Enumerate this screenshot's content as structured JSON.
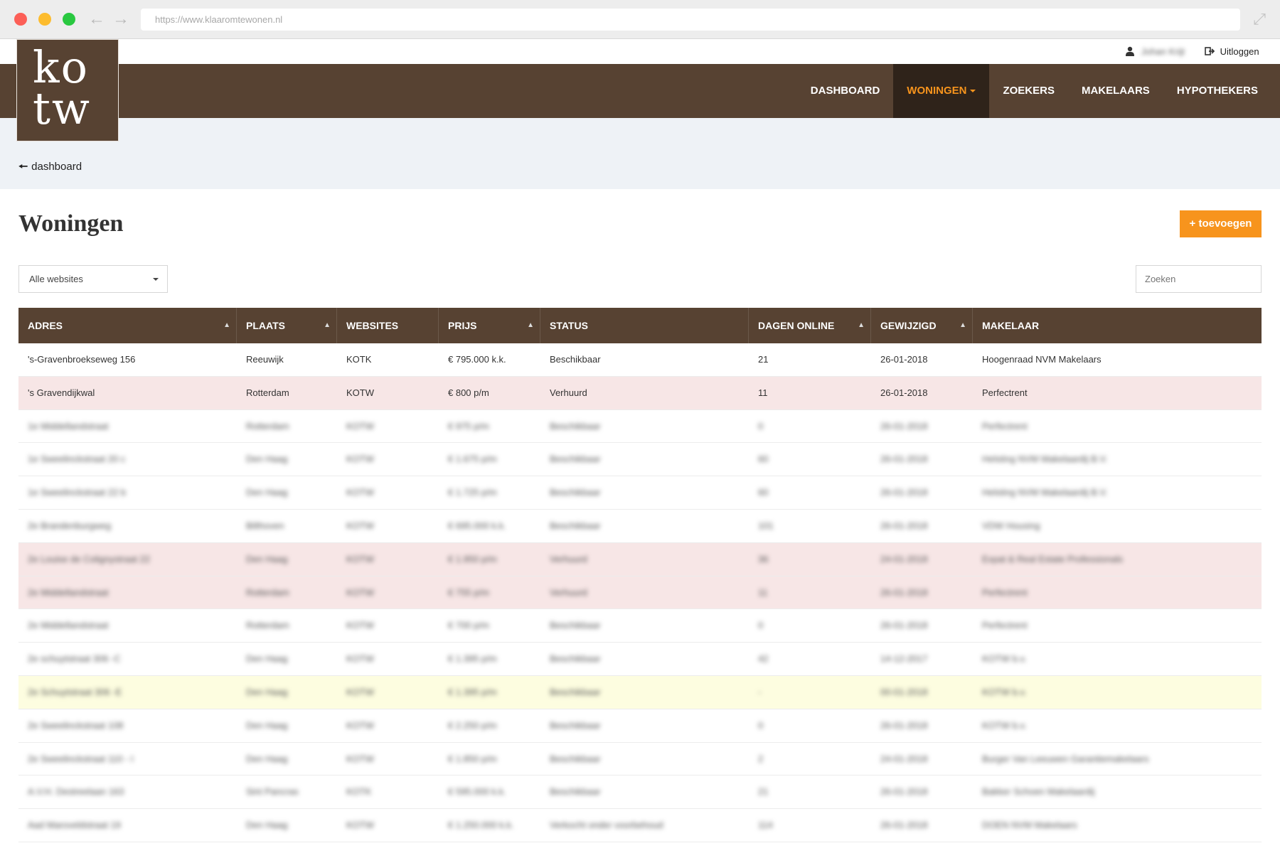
{
  "browser": {
    "url": "https://www.klaaromtewonen.nl"
  },
  "utility": {
    "user_name": "Johan Krijt",
    "logout_label": "Uitloggen"
  },
  "logo": {
    "line1": "ko",
    "line2": "tw"
  },
  "nav": {
    "items": [
      {
        "label": "DASHBOARD",
        "active": false
      },
      {
        "label": "WONINGEN",
        "active": true
      },
      {
        "label": "ZOEKERS",
        "active": false
      },
      {
        "label": "MAKELAARS",
        "active": false
      },
      {
        "label": "HYPOTHEKERS",
        "active": false
      }
    ]
  },
  "breadcrumb": {
    "back_label": "dashboard"
  },
  "page": {
    "title": "Woningen",
    "add_label": "+ toevoegen"
  },
  "filters": {
    "website_select": "Alle websites",
    "search_placeholder": "Zoeken"
  },
  "table": {
    "columns": [
      "ADRES",
      "PLAATS",
      "WEBSITES",
      "PRIJS",
      "STATUS",
      "DAGEN ONLINE",
      "GEWIJZIGD",
      "MAKELAAR"
    ],
    "rows": [
      {
        "adres": "'s-Gravenbroekseweg 156",
        "plaats": "Reeuwijk",
        "websites": "KOTK",
        "prijs": "€ 795.000 k.k.",
        "status": "Beschikbaar",
        "dagen": "21",
        "gewijzigd": "26-01-2018",
        "makelaar": "Hoogenraad NVM Makelaars",
        "highlight": "none",
        "blur": false
      },
      {
        "adres": "'s Gravendijkwal",
        "plaats": "Rotterdam",
        "websites": "KOTW",
        "prijs": "€ 800 p/m",
        "status": "Verhuurd",
        "dagen": "11",
        "gewijzigd": "26-01-2018",
        "makelaar": "Perfectrent",
        "highlight": "red",
        "blur": false
      },
      {
        "adres": "1e Middellandstraat",
        "plaats": "Rotterdam",
        "websites": "KOTW",
        "prijs": "€ 975 p/m",
        "status": "Beschikbaar",
        "dagen": "0",
        "gewijzigd": "26-01-2018",
        "makelaar": "Perfectrent",
        "highlight": "none",
        "blur": true
      },
      {
        "adres": "1e Sweelinckstraat 20 c",
        "plaats": "Den Haag",
        "websites": "KOTW",
        "prijs": "€ 1.675 p/m",
        "status": "Beschikbaar",
        "dagen": "60",
        "gewijzigd": "26-01-2018",
        "makelaar": "Helsting NVM Makelaardij B.V.",
        "highlight": "none",
        "blur": true
      },
      {
        "adres": "1e Sweelinckstraat 22 b",
        "plaats": "Den Haag",
        "websites": "KOTW",
        "prijs": "€ 1.725 p/m",
        "status": "Beschikbaar",
        "dagen": "60",
        "gewijzigd": "26-01-2018",
        "makelaar": "Helsting NVM Makelaardij B.V.",
        "highlight": "none",
        "blur": true
      },
      {
        "adres": "2e Brandenburgweg",
        "plaats": "Bilthoven",
        "websites": "KOTW",
        "prijs": "€ 695.000 k.k.",
        "status": "Beschikbaar",
        "dagen": "101",
        "gewijzigd": "26-01-2018",
        "makelaar": "VDW Housing",
        "highlight": "none",
        "blur": true
      },
      {
        "adres": "2e Louise de Colignystraat 22",
        "plaats": "Den Haag",
        "websites": "KOTW",
        "prijs": "€ 1.950 p/m",
        "status": "Verhuurd",
        "dagen": "36",
        "gewijzigd": "24-01-2018",
        "makelaar": "Expat & Real Estate Professionals",
        "highlight": "red",
        "blur": true
      },
      {
        "adres": "2e Middellandstraat",
        "plaats": "Rotterdam",
        "websites": "KOTW",
        "prijs": "€ 755 p/m",
        "status": "Verhuurd",
        "dagen": "11",
        "gewijzigd": "26-01-2018",
        "makelaar": "Perfectrent",
        "highlight": "red",
        "blur": true
      },
      {
        "adres": "2e Middellandstraat",
        "plaats": "Rotterdam",
        "websites": "KOTW",
        "prijs": "€ 700 p/m",
        "status": "Beschikbaar",
        "dagen": "0",
        "gewijzigd": "26-01-2018",
        "makelaar": "Perfectrent",
        "highlight": "none",
        "blur": true
      },
      {
        "adres": "2e schuytstraat 306 -C",
        "plaats": "Den Haag",
        "websites": "KOTW",
        "prijs": "€ 1.395 p/m",
        "status": "Beschikbaar",
        "dagen": "42",
        "gewijzigd": "14-12-2017",
        "makelaar": "KOTW b.v.",
        "highlight": "none",
        "blur": true
      },
      {
        "adres": "2e Schuytstraat 306 -E",
        "plaats": "Den Haag",
        "websites": "KOTW",
        "prijs": "€ 1.395 p/m",
        "status": "Beschikbaar",
        "dagen": "-",
        "gewijzigd": "00-01-2018",
        "makelaar": "KOTW b.v.",
        "highlight": "yellow",
        "blur": true
      },
      {
        "adres": "2e Sweelinckstraat 108",
        "plaats": "Den Haag",
        "websites": "KOTW",
        "prijs": "€ 2.250 p/m",
        "status": "Beschikbaar",
        "dagen": "0",
        "gewijzigd": "26-01-2018",
        "makelaar": "KOTW b.v.",
        "highlight": "none",
        "blur": true
      },
      {
        "adres": "2e Sweelinckstraat 110 - I",
        "plaats": "Den Haag",
        "websites": "KOTW",
        "prijs": "€ 1.850 p/m",
        "status": "Beschikbaar",
        "dagen": "2",
        "gewijzigd": "24-01-2018",
        "makelaar": "Burger Van Leeuwen Garantiemakelaars",
        "highlight": "none",
        "blur": true
      },
      {
        "adres": "A.V.H. Destreelaan 163",
        "plaats": "Sint Pancras",
        "websites": "KOTK",
        "prijs": "€ 595.000 k.k.",
        "status": "Beschikbaar",
        "dagen": "21",
        "gewijzigd": "26-01-2018",
        "makelaar": "Bakker Schoen Makelaardij",
        "highlight": "none",
        "blur": true
      },
      {
        "adres": "Aad Maroveldstraat 19",
        "plaats": "Den Haag",
        "websites": "KOTW",
        "prijs": "€ 1.250.000 k.k.",
        "status": "Verkocht onder voorbehoud",
        "dagen": "114",
        "gewijzigd": "26-01-2018",
        "makelaar": "DOEN NVM Makelaars",
        "highlight": "none",
        "blur": true
      }
    ]
  }
}
